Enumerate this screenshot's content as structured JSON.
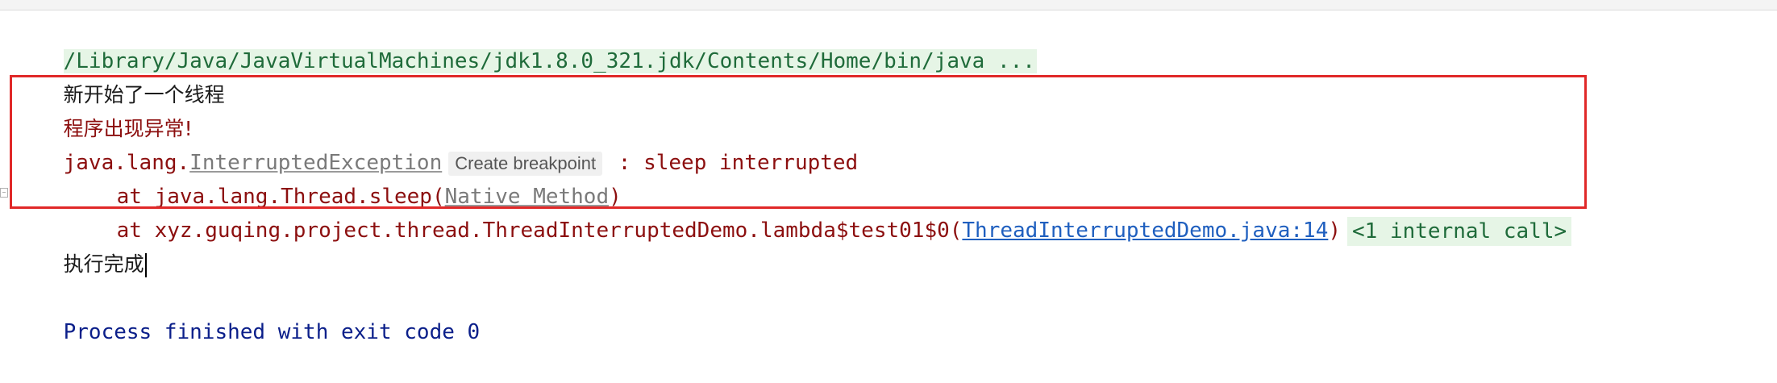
{
  "console": {
    "command_line": "/Library/Java/JavaVirtualMachines/jdk1.8.0_321.jdk/Contents/Home/bin/java ...",
    "line_thread_started": "新开始了一个线程",
    "line_exception_msg": "程序出现异常!",
    "exception": {
      "prefix": "java.lang.",
      "class_name": "InterruptedException",
      "breakpoint_chip": "Create breakpoint",
      "message": " : sleep interrupted"
    },
    "stack": [
      {
        "at_text": "at java.lang.Thread.sleep(",
        "link_text": "Native Method",
        "suffix": ")"
      },
      {
        "at_text": "at xyz.guqing.project.thread.ThreadInterruptedDemo.lambda$test01$0(",
        "link_text": "ThreadInterruptedDemo.java:14",
        "suffix": ")",
        "internal_calls": "<1 internal call>"
      }
    ],
    "line_done": "执行完成",
    "exit_line": "Process finished with exit code 0"
  },
  "colors": {
    "highlight_border": "#e02828",
    "error_text": "#8c0f0f",
    "link": "#1f5fbf",
    "exit_text": "#0b1f8a",
    "command_bg": "#e6f5e6"
  }
}
